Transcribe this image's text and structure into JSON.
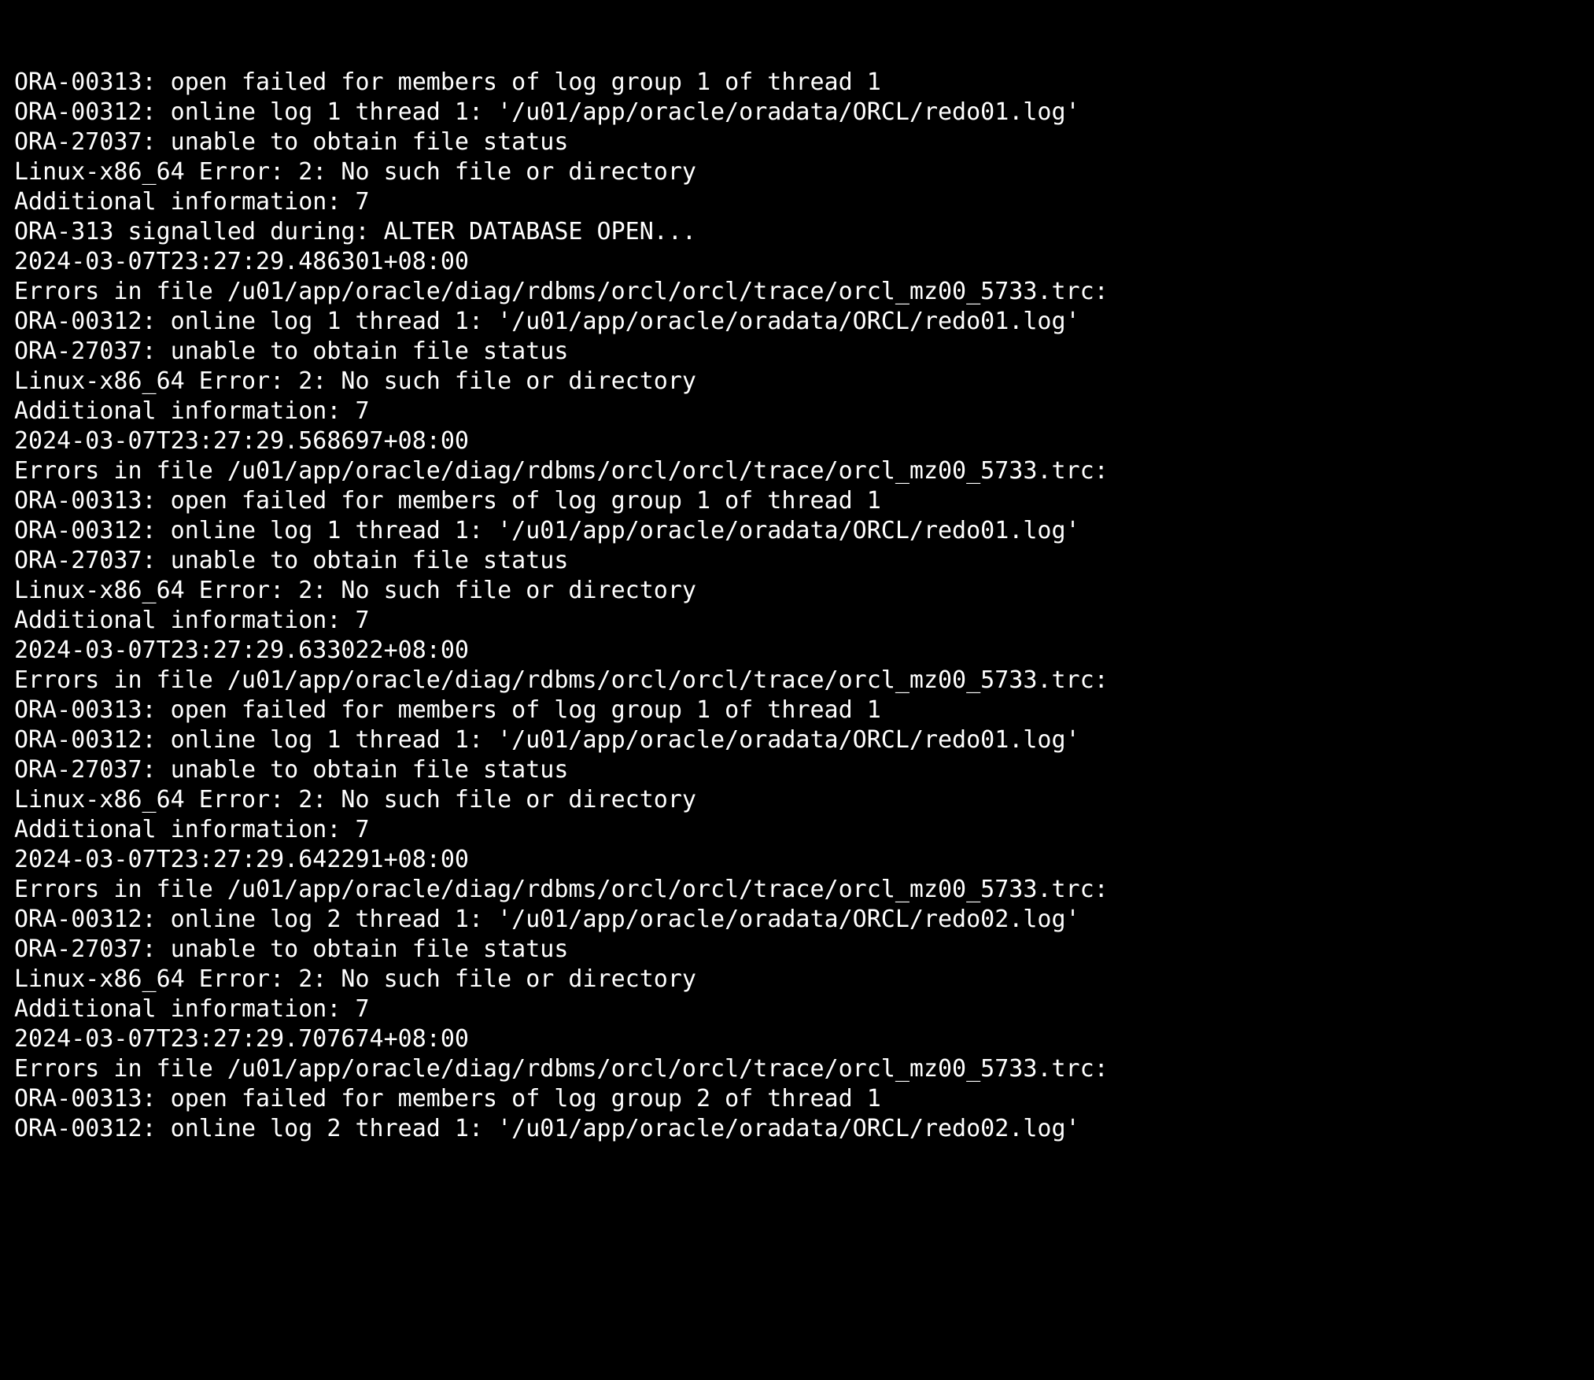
{
  "window": {
    "type": "terminal-console",
    "background_color": "#000000",
    "foreground_color": "#ffffff",
    "font_style": "monospace"
  },
  "terminal": {
    "name": "oracle-alert-log-output",
    "lines": [
      "ORA-00313: open failed for members of log group 1 of thread 1",
      "ORA-00312: online log 1 thread 1: '/u01/app/oracle/oradata/ORCL/redo01.log'",
      "ORA-27037: unable to obtain file status",
      "Linux-x86_64 Error: 2: No such file or directory",
      "Additional information: 7",
      "ORA-313 signalled during: ALTER DATABASE OPEN...",
      "2024-03-07T23:27:29.486301+08:00",
      "Errors in file /u01/app/oracle/diag/rdbms/orcl/orcl/trace/orcl_mz00_5733.trc:",
      "ORA-00312: online log 1 thread 1: '/u01/app/oracle/oradata/ORCL/redo01.log'",
      "ORA-27037: unable to obtain file status",
      "Linux-x86_64 Error: 2: No such file or directory",
      "Additional information: 7",
      "2024-03-07T23:27:29.568697+08:00",
      "Errors in file /u01/app/oracle/diag/rdbms/orcl/orcl/trace/orcl_mz00_5733.trc:",
      "ORA-00313: open failed for members of log group 1 of thread 1",
      "ORA-00312: online log 1 thread 1: '/u01/app/oracle/oradata/ORCL/redo01.log'",
      "ORA-27037: unable to obtain file status",
      "Linux-x86_64 Error: 2: No such file or directory",
      "Additional information: 7",
      "2024-03-07T23:27:29.633022+08:00",
      "Errors in file /u01/app/oracle/diag/rdbms/orcl/orcl/trace/orcl_mz00_5733.trc:",
      "ORA-00313: open failed for members of log group 1 of thread 1",
      "ORA-00312: online log 1 thread 1: '/u01/app/oracle/oradata/ORCL/redo01.log'",
      "ORA-27037: unable to obtain file status",
      "Linux-x86_64 Error: 2: No such file or directory",
      "Additional information: 7",
      "2024-03-07T23:27:29.642291+08:00",
      "Errors in file /u01/app/oracle/diag/rdbms/orcl/orcl/trace/orcl_mz00_5733.trc:",
      "ORA-00312: online log 2 thread 1: '/u01/app/oracle/oradata/ORCL/redo02.log'",
      "ORA-27037: unable to obtain file status",
      "Linux-x86_64 Error: 2: No such file or directory",
      "Additional information: 7",
      "2024-03-07T23:27:29.707674+08:00",
      "Errors in file /u01/app/oracle/diag/rdbms/orcl/orcl/trace/orcl_mz00_5733.trc:",
      "ORA-00313: open failed for members of log group 2 of thread 1",
      "ORA-00312: online log 2 thread 1: '/u01/app/oracle/oradata/ORCL/redo02.log'"
    ]
  }
}
